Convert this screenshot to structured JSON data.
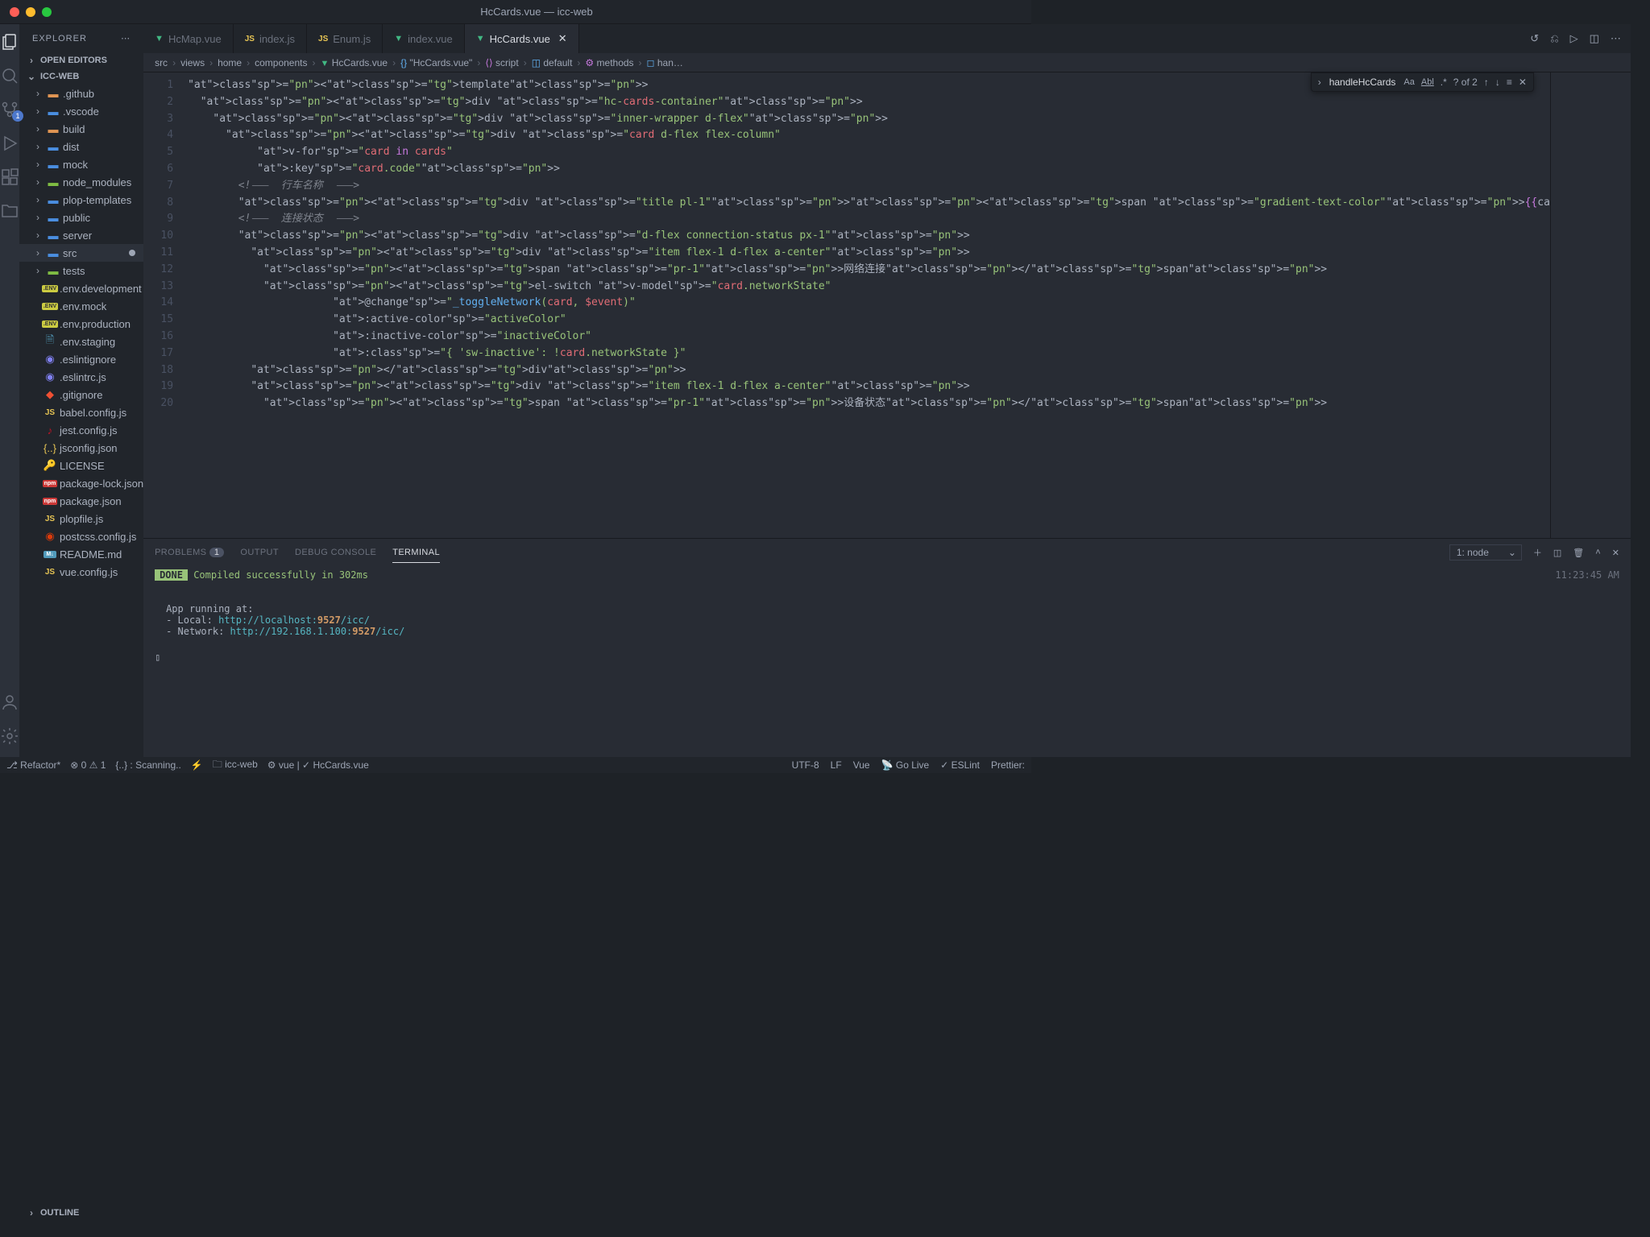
{
  "window": {
    "title": "HcCards.vue — icc-web"
  },
  "sidebar": {
    "title": "EXPLORER",
    "open_editors": "OPEN EDITORS",
    "workspace": "ICC-WEB",
    "outline": "OUTLINE",
    "tree": [
      {
        "type": "folder",
        "name": ".github",
        "iconColor": "orange"
      },
      {
        "type": "folder",
        "name": ".vscode",
        "iconColor": "blue-alt"
      },
      {
        "type": "folder",
        "name": "build",
        "iconColor": "orange"
      },
      {
        "type": "folder",
        "name": "dist",
        "iconColor": "blue"
      },
      {
        "type": "folder",
        "name": "mock",
        "iconColor": "blue"
      },
      {
        "type": "folder",
        "name": "node_modules",
        "iconColor": "green"
      },
      {
        "type": "folder",
        "name": "plop-templates",
        "iconColor": "blue"
      },
      {
        "type": "folder",
        "name": "public",
        "iconColor": "blue"
      },
      {
        "type": "folder",
        "name": "server",
        "iconColor": "blue"
      },
      {
        "type": "folder",
        "name": "src",
        "iconColor": "blue",
        "selected": true,
        "modified": true
      },
      {
        "type": "folder",
        "name": "tests",
        "iconColor": "green"
      },
      {
        "type": "file",
        "name": ".env.development",
        "icon": "env"
      },
      {
        "type": "file",
        "name": ".env.mock",
        "icon": "env"
      },
      {
        "type": "file",
        "name": ".env.production",
        "icon": "env"
      },
      {
        "type": "file",
        "name": ".env.staging",
        "icon": "file"
      },
      {
        "type": "file",
        "name": ".eslintignore",
        "icon": "eslint"
      },
      {
        "type": "file",
        "name": ".eslintrc.js",
        "icon": "eslint"
      },
      {
        "type": "file",
        "name": ".gitignore",
        "icon": "git"
      },
      {
        "type": "file",
        "name": "babel.config.js",
        "icon": "js"
      },
      {
        "type": "file",
        "name": "jest.config.js",
        "icon": "jest"
      },
      {
        "type": "file",
        "name": "jsconfig.json",
        "icon": "json"
      },
      {
        "type": "file",
        "name": "LICENSE",
        "icon": "license"
      },
      {
        "type": "file",
        "name": "package-lock.json",
        "icon": "npm"
      },
      {
        "type": "file",
        "name": "package.json",
        "icon": "npm"
      },
      {
        "type": "file",
        "name": "plopfile.js",
        "icon": "js"
      },
      {
        "type": "file",
        "name": "postcss.config.js",
        "icon": "postcss"
      },
      {
        "type": "file",
        "name": "README.md",
        "icon": "md"
      },
      {
        "type": "file",
        "name": "vue.config.js",
        "icon": "js"
      }
    ]
  },
  "scm_badge": "1",
  "tabs": [
    {
      "label": "HcMap.vue",
      "icon": "vue"
    },
    {
      "label": "index.js",
      "icon": "js"
    },
    {
      "label": "Enum.js",
      "icon": "js"
    },
    {
      "label": "index.vue",
      "icon": "vue"
    },
    {
      "label": "HcCards.vue",
      "icon": "vue",
      "active": true
    }
  ],
  "breadcrumb": [
    "src",
    "views",
    "home",
    "components",
    "HcCards.vue",
    "\"HcCards.vue\"",
    "script",
    "default",
    "methods",
    "han…"
  ],
  "find": {
    "value": "handleHcCards",
    "result": "? of 2"
  },
  "code_lines": [
    "<template>",
    "  <div class=\"hc-cards-container\">",
    "    <div class=\"inner-wrapper d-flex\">",
    "      <div class=\"card d-flex flex-column\"",
    "           v-for=\"card in cards\"",
    "           :key=\"card.code\">",
    "        <!-- 行车名称 -->",
    "        <div class=\"title pl-1\"><span class=\"gradient-text-color\">{{ca",
    "        <!-- 连接状态 -->",
    "        <div class=\"d-flex connection-status px-1\">",
    "          <div class=\"item flex-1 d-flex a-center\">",
    "            <span class=\"pr-1\">网络连接</span>",
    "            <el-switch v-model=\"card.networkState\"",
    "                       @change=\"_toggleNetwork(card, $event)\"",
    "                       :active-color=\"activeColor\"",
    "                       :inactive-color=\"inactiveColor\"",
    "                       :class=\"{ 'sw-inactive': !card.networkState }\" ",
    "          </div>",
    "          <div class=\"item flex-1 d-flex a-center\">",
    "            <span class=\"pr-1\">设备状态</span>"
  ],
  "line_start": 1,
  "panel": {
    "tabs": {
      "problems": "PROBLEMS",
      "problems_badge": "1",
      "output": "OUTPUT",
      "debug": "DEBUG CONSOLE",
      "terminal": "TERMINAL"
    },
    "task": "1: node",
    "timestamp": "11:23:45 AM",
    "done_label": "DONE",
    "done_msg": "Compiled successfully in 302ms",
    "running": "App running at:",
    "local_label": "- Local:   ",
    "local_url_pre": "http://localhost:",
    "local_port": "9527",
    "local_path": "/icc/",
    "net_label": "- Network: ",
    "net_url_pre": "http://192.168.1.100:",
    "net_port": "9527",
    "net_path": "/icc/"
  },
  "status": {
    "branch": "Refactor*",
    "errors": "0",
    "warnings": "1",
    "scanning": "{..} : Scanning..",
    "folder": "icc-web",
    "lang_ctx": "vue",
    "file_ctx": "HcCards.vue",
    "encoding": "UTF-8",
    "eol": "LF",
    "language": "Vue",
    "golive": "Go Live",
    "eslint": "ESLint",
    "prettier": "Prettier: "
  }
}
